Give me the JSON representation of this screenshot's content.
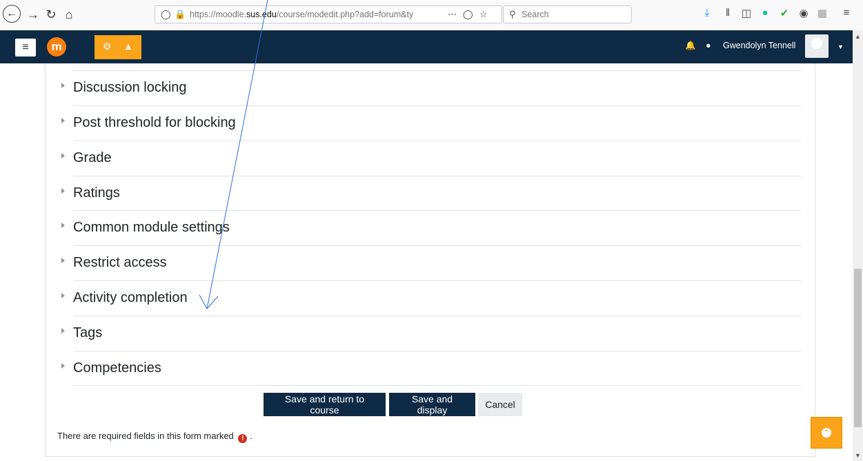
{
  "browser": {
    "url_prefix": "https://moodle.",
    "url_domain": "sus.edu",
    "url_path": "/course/modedit.php?add=forum&ty",
    "search_placeholder": "Search"
  },
  "navbar": {
    "user_name": "Gwendolyn Tennell"
  },
  "sections": [
    {
      "label": "Discussion locking"
    },
    {
      "label": "Post threshold for blocking"
    },
    {
      "label": "Grade"
    },
    {
      "label": "Ratings"
    },
    {
      "label": "Common module settings"
    },
    {
      "label": "Restrict access"
    },
    {
      "label": "Activity completion"
    },
    {
      "label": "Tags"
    },
    {
      "label": "Competencies"
    }
  ],
  "buttons": {
    "save_return": "Save and return to course",
    "save_display": "Save and display",
    "cancel": "Cancel"
  },
  "footer": {
    "required_note": "There are required fields in this form marked",
    "required_suffix": "."
  },
  "colors": {
    "navbar": "#0f2a44",
    "accent_orange": "#f9a41a",
    "required_red": "#ca3120"
  }
}
